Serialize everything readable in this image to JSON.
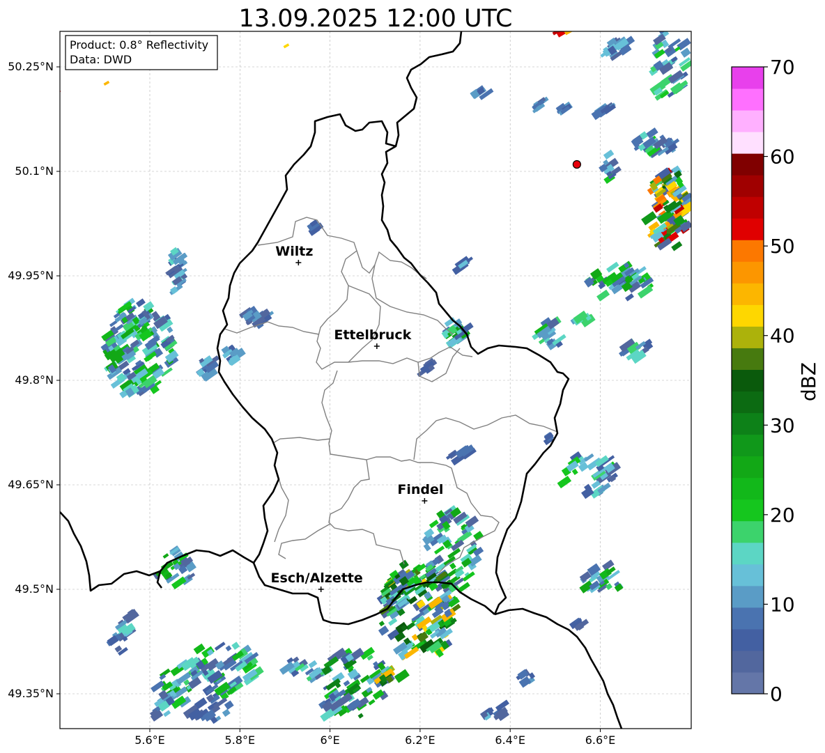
{
  "title": "13.09.2025 12:00 UTC",
  "info": {
    "product": "Product: 0.8° Reflectivity",
    "data": "Data: DWD"
  },
  "map": {
    "lon_range": [
      5.4,
      6.8
    ],
    "lat_range": [
      49.3,
      50.3
    ],
    "grid": true,
    "x_ticks": [
      {
        "value": 5.6,
        "label": "5.6°E"
      },
      {
        "value": 5.8,
        "label": "5.8°E"
      },
      {
        "value": 6.0,
        "label": "6°E"
      },
      {
        "value": 6.2,
        "label": "6.2°E"
      },
      {
        "value": 6.4,
        "label": "6.4°E"
      },
      {
        "value": 6.6,
        "label": "6.6°E"
      }
    ],
    "y_ticks": [
      {
        "value": 50.25,
        "label": "50.25°N"
      },
      {
        "value": 50.1,
        "label": "50.1°N"
      },
      {
        "value": 49.95,
        "label": "49.95°N"
      },
      {
        "value": 49.8,
        "label": "49.8°N"
      },
      {
        "value": 49.65,
        "label": "49.65°N"
      },
      {
        "value": 49.5,
        "label": "49.5°N"
      },
      {
        "value": 49.35,
        "label": "49.35°N"
      }
    ],
    "cities": [
      {
        "name": "Wiltz",
        "lon": 5.93,
        "lat": 49.969
      },
      {
        "name": "Ettelbruck",
        "lon": 6.104,
        "lat": 49.849
      },
      {
        "name": "Findel",
        "lon": 6.21,
        "lat": 49.627
      },
      {
        "name": "Esch/Alzette",
        "lon": 5.98,
        "lat": 49.5
      }
    ],
    "radar_site": {
      "lon": 6.548,
      "lat": 50.11,
      "color": "#e8000b"
    }
  },
  "colorbar": {
    "label": "dBZ",
    "min": 0,
    "max": 70,
    "ticks": [
      "0",
      "10",
      "20",
      "30",
      "40",
      "50",
      "60",
      "70"
    ],
    "colors": [
      "#6476a8",
      "#52679e",
      "#4360a2",
      "#4a73b0",
      "#5a9cc6",
      "#67c0d8",
      "#5cd6c4",
      "#3cd36c",
      "#15c61e",
      "#12b81a",
      "#12a816",
      "#10981a",
      "#0d8118",
      "#0c6b12",
      "#0a5a0c",
      "#477a0f",
      "#acb20b",
      "#fed700",
      "#fcb600",
      "#fc9600",
      "#fc7800",
      "#e00000",
      "#c00000",
      "#a00000",
      "#800000",
      "#ffe0ff",
      "#ffb0ff",
      "#ff70ff",
      "#e840ec"
    ]
  }
}
